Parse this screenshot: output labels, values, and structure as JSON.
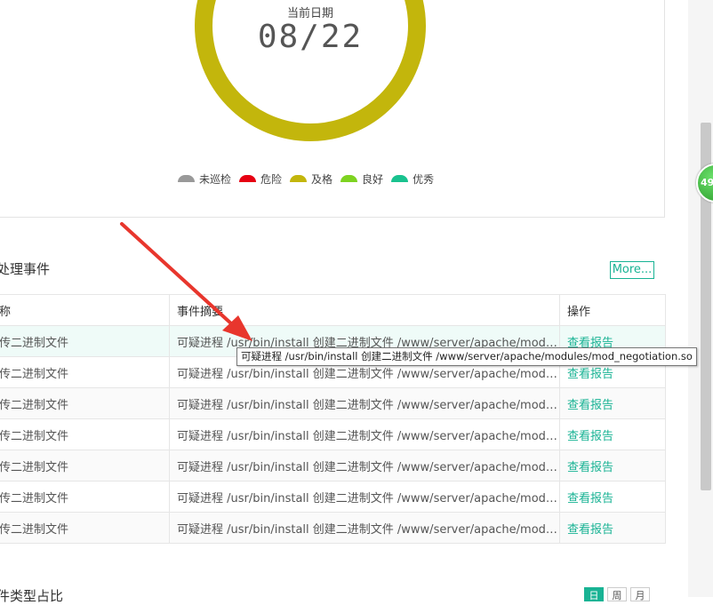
{
  "gauge": {
    "caption": "当前日期",
    "value": "08/22",
    "ring_color": "#c3b60c"
  },
  "legend": [
    {
      "label": "未巡检",
      "color": "#999999"
    },
    {
      "label": "危险",
      "color": "#e60012"
    },
    {
      "label": "及格",
      "color": "#c3b60c"
    },
    {
      "label": "良好",
      "color": "#7ed321"
    },
    {
      "label": "优秀",
      "color": "#19c28f"
    }
  ],
  "score_bubble": "49",
  "events": {
    "title": "处理事件",
    "more_label": "More...",
    "columns": [
      "称",
      "事件摘要",
      "操作"
    ],
    "rows": [
      {
        "name": "传二进制文件",
        "summary": "可疑进程 /usr/bin/install 创建二进制文件 /www/server/apache/modules/mod_negotiation.so",
        "action": "查看报告"
      },
      {
        "name": "传二进制文件",
        "summary": "可疑进程 /usr/bin/install 创建二进制文件 /www/server/apache/modules/mod_negotiation.so",
        "action": "查看报告"
      },
      {
        "name": "传二进制文件",
        "summary": "可疑进程 /usr/bin/install 创建二进制文件 /www/server/apache/modules/mod_negotiation.so",
        "action": "查看报告"
      },
      {
        "name": "传二进制文件",
        "summary": "可疑进程 /usr/bin/install 创建二进制文件 /www/server/apache/modules/mod_negotiation.so",
        "action": "查看报告"
      },
      {
        "name": "传二进制文件",
        "summary": "可疑进程 /usr/bin/install 创建二进制文件 /www/server/apache/modules/mod_negotiation.so",
        "action": "查看报告"
      },
      {
        "name": "传二进制文件",
        "summary": "可疑进程 /usr/bin/install 创建二进制文件 /www/server/apache/modules/mod_negotiation.so",
        "action": "查看报告"
      },
      {
        "name": "传二进制文件",
        "summary": "可疑进程 /usr/bin/install 创建二进制文件 /www/server/apache/modules/mod_negotiation.so",
        "action": "查看报告"
      }
    ],
    "tooltip": "可疑进程 /usr/bin/install 创建二进制文件 /www/server/apache/modules/mod_negotiation.so"
  },
  "bottom": {
    "title": "件类型占比",
    "view_buttons": [
      "日",
      "周",
      "月"
    ]
  },
  "annotation_arrow_color": "#e8362d"
}
